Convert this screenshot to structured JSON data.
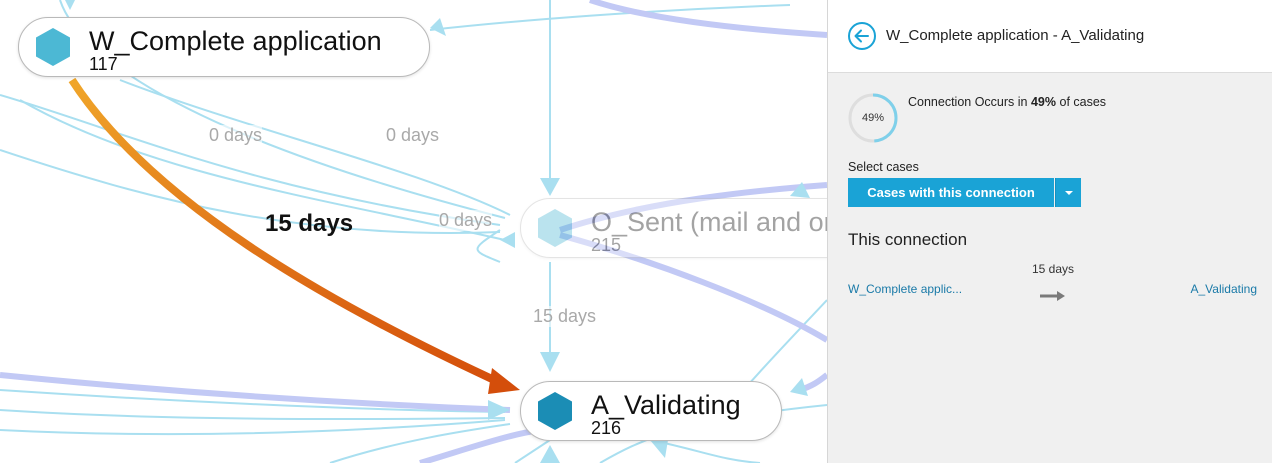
{
  "canvas": {
    "nodes": [
      {
        "title": "W_Complete application",
        "count": "117",
        "color": "#4cb8d4"
      },
      {
        "title": "O_Sent (mail and online)",
        "count": "215",
        "color": "#4cb8d4"
      },
      {
        "title": "A_Validating",
        "count": "216",
        "color": "#1b8db5"
      }
    ],
    "edge_labels": {
      "e1": "0 days",
      "e2": "0 days",
      "e3": "0 days",
      "e4": "15 days",
      "active": "15 days"
    },
    "colors": {
      "active_edge_start": "#f0a62a",
      "active_edge_end": "#d44e0b",
      "edge": "#b9c4f3",
      "edge_light": "#a9dff0"
    }
  },
  "panel": {
    "title": "W_Complete application - A_Validating",
    "percent_label": "49%",
    "percent_value": 0.49,
    "occurs_prefix": "Connection Occurs in ",
    "occurs_bold": "49%",
    "occurs_suffix": " of cases",
    "select_label": "Select cases",
    "select_button": "Cases with this connection",
    "section_title": "This connection",
    "connection": {
      "days": "15 days",
      "from": "W_Complete applic...",
      "to": "A_Validating"
    },
    "accent_color": "#1aa3d6",
    "icons": [
      "arrow-left-circle-icon",
      "caret-down-icon",
      "arrow-right-icon"
    ]
  }
}
